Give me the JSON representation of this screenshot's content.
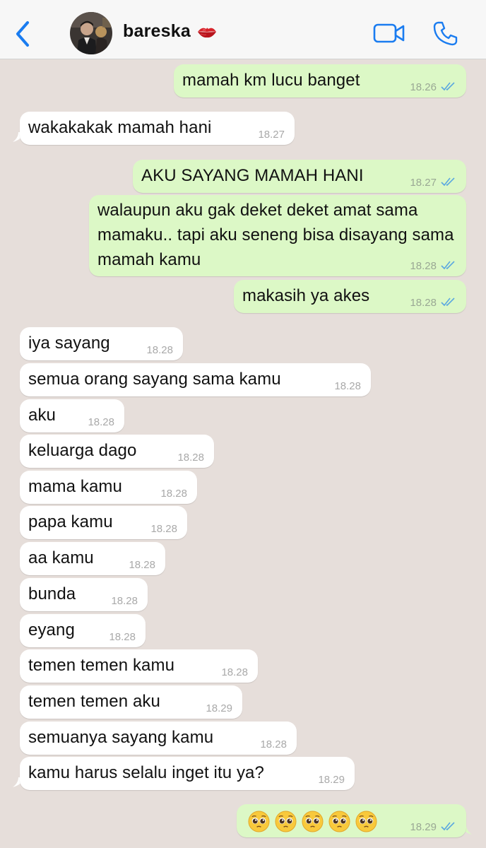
{
  "header": {
    "contact_name": "bareska",
    "back_icon": "chevron-left-icon",
    "status_emoji": "kiss-mark-icon",
    "video_icon": "video-camera-icon",
    "call_icon": "phone-icon",
    "accent_color": "#1a7cf0"
  },
  "messages": [
    {
      "dir": "out",
      "text": "mamah km lucu banget",
      "time": "18.26",
      "read": true
    },
    {
      "dir": "in",
      "text": "wakakakak mamah hani",
      "time": "18.27"
    },
    {
      "dir": "out",
      "text": "AKU SAYANG MAMAH HANI",
      "time": "18.27",
      "read": true
    },
    {
      "dir": "out",
      "text": "walaupun aku gak deket deket amat sama mamaku.. tapi aku seneng bisa disayang sama mamah kamu",
      "time": "18.28",
      "read": true
    },
    {
      "dir": "out",
      "text": "makasih ya akes",
      "time": "18.28",
      "read": true
    },
    {
      "dir": "in",
      "text": "iya sayang",
      "time": "18.28"
    },
    {
      "dir": "in",
      "text": "semua orang sayang sama kamu",
      "time": "18.28"
    },
    {
      "dir": "in",
      "text": "aku",
      "time": "18.28"
    },
    {
      "dir": "in",
      "text": "keluarga dago",
      "time": "18.28"
    },
    {
      "dir": "in",
      "text": "mama kamu",
      "time": "18.28"
    },
    {
      "dir": "in",
      "text": "papa kamu",
      "time": "18.28"
    },
    {
      "dir": "in",
      "text": "aa kamu",
      "time": "18.28"
    },
    {
      "dir": "in",
      "text": "bunda",
      "time": "18.28"
    },
    {
      "dir": "in",
      "text": "eyang",
      "time": "18.28"
    },
    {
      "dir": "in",
      "text": "temen temen kamu",
      "time": "18.28"
    },
    {
      "dir": "in",
      "text": "temen temen aku",
      "time": "18.29"
    },
    {
      "dir": "in",
      "text": "semuanya sayang kamu",
      "time": "18.28"
    },
    {
      "dir": "in",
      "text": "kamu harus selalu inget itu ya?",
      "time": "18.29"
    },
    {
      "dir": "out",
      "text": "🥹🥹🥹🥹🥹",
      "emoji": "pleading-face-icon",
      "emoji_count": 5,
      "time": "18.29",
      "read": true
    }
  ],
  "colors": {
    "background": "#e6deda",
    "incoming_bubble": "#ffffff",
    "outgoing_bubble": "#dcf8c6",
    "read_tick": "#5aa7e0"
  }
}
